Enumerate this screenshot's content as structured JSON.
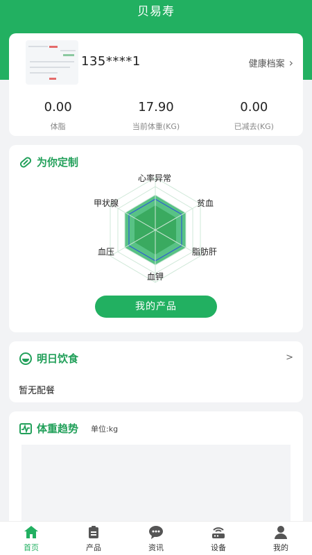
{
  "app": {
    "title": "贝易寿"
  },
  "profile": {
    "phone": "135****1",
    "health_record": "健康档案",
    "stats": [
      {
        "value": "0.00",
        "label": "体脂"
      },
      {
        "value": "17.90",
        "label": "当前体重(KG)"
      },
      {
        "value": "0.00",
        "label": "已减去(KG)"
      }
    ]
  },
  "custom": {
    "title": "为你定制",
    "radar_labels": [
      "心率异常",
      "贫血",
      "脂肪肝",
      "血钾",
      "血压",
      "甲状腺"
    ],
    "button": "我的产品"
  },
  "meal": {
    "title": "明日饮食",
    "arrow": ">",
    "status": "暂无配餐"
  },
  "weight": {
    "title": "体重趋势",
    "unit": "单位:kg"
  },
  "tabs": [
    {
      "label": "首页",
      "icon": "home-icon",
      "active": true
    },
    {
      "label": "产品",
      "icon": "clipboard-icon",
      "active": false
    },
    {
      "label": "资讯",
      "icon": "chat-icon",
      "active": false
    },
    {
      "label": "设备",
      "icon": "router-icon",
      "active": false
    },
    {
      "label": "我的",
      "icon": "user-icon",
      "active": false
    }
  ],
  "colors": {
    "brand": "#22b061",
    "active_tab": "#22b061"
  }
}
